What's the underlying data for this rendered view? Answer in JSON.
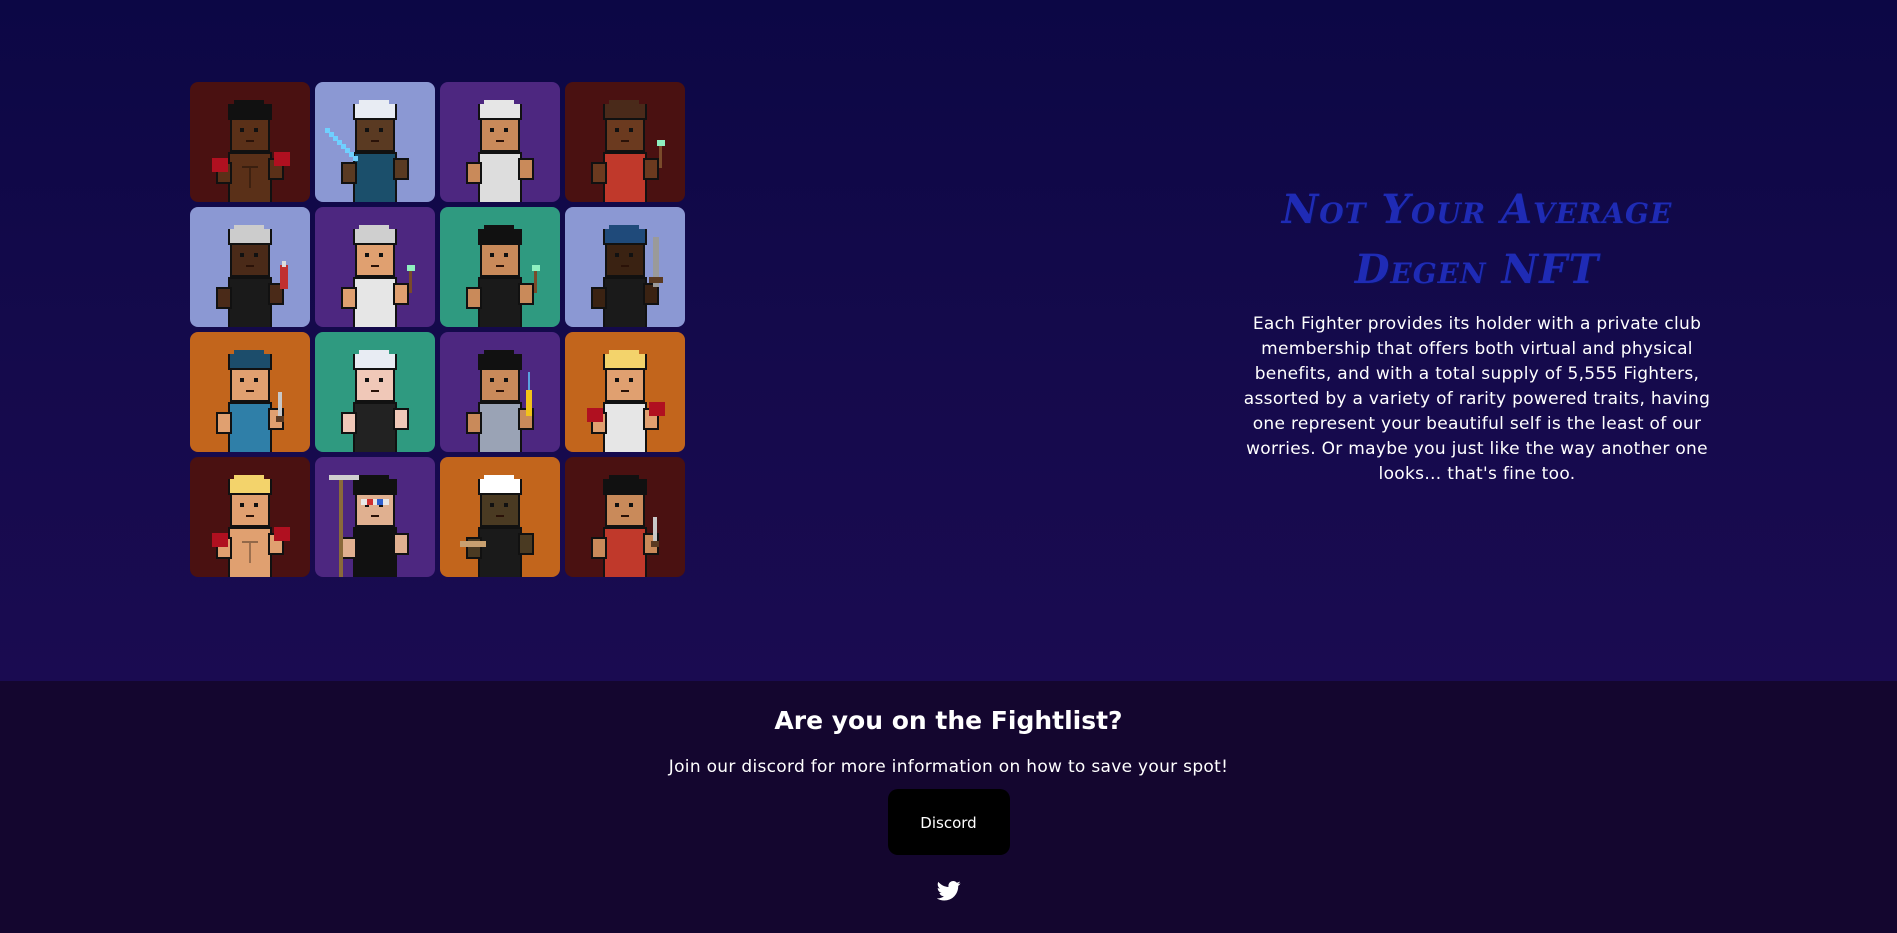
{
  "hero": {
    "headline_line1": "Not Your Average",
    "headline_line2": "Degen NFT",
    "description": "Each Fighter provides its holder with a private club membership that offers both virtual and physical benefits, and with a total supply of 5,555 Fighters, assorted by a variety of rarity powered traits, having one represent your beautiful self is the least of our worries. Or maybe you just like the way another one looks… that's fine too.",
    "headline_color": "#1f2bb5"
  },
  "gallery": {
    "tiles": [
      {
        "bg": "#4a1111",
        "skin": "#5a3018",
        "hair": "#111111",
        "shirt": "none",
        "item": "gloves"
      },
      {
        "bg": "#8b98d3",
        "skin": "#5a3a22",
        "hair": "#e8ecf3",
        "shirt": "#1b4f6b",
        "item": "saber"
      },
      {
        "bg": "#4d2780",
        "skin": "#c98a5a",
        "hair": "#e6e6e6",
        "shirt": "#dddddd",
        "item": "none"
      },
      {
        "bg": "#4a1111",
        "skin": "#6b3a1f",
        "hair": "#4a2a1a",
        "shirt": "#c0392b",
        "item": "wand"
      },
      {
        "bg": "#8b98d3",
        "skin": "#4a2a18",
        "hair": "#cccccc",
        "shirt": "#1a1a1a",
        "item": "bottle"
      },
      {
        "bg": "#4d2780",
        "skin": "#e0a070",
        "hair": "#cfcfcf",
        "shirt": "#e6e6e6",
        "item": "wand"
      },
      {
        "bg": "#2f9a80",
        "skin": "#c98a5a",
        "hair": "#111111",
        "shirt": "#1a1a1a",
        "item": "wand"
      },
      {
        "bg": "#8b98d3",
        "skin": "#3a2212",
        "hair": "#1f4a7a",
        "shirt": "#1a1a1a",
        "item": "gun"
      },
      {
        "bg": "#c2651c",
        "skin": "#e0a070",
        "hair": "#1c4d6b",
        "shirt": "#2f7fa8",
        "item": "knife"
      },
      {
        "bg": "#2f9a80",
        "skin": "#f0c8b8",
        "hair": "#e8ecf3",
        "shirt": "#222222",
        "item": "none"
      },
      {
        "bg": "#4d2780",
        "skin": "#c98a5a",
        "hair": "#111111",
        "shirt": "#9aa3b5",
        "item": "banana"
      },
      {
        "bg": "#c2651c",
        "skin": "#e0a070",
        "hair": "#f3d36b",
        "shirt": "#e6e6e6",
        "item": "gloves"
      },
      {
        "bg": "#4a1111",
        "skin": "#e0a070",
        "hair": "#f3d36b",
        "shirt": "none",
        "item": "gloves"
      },
      {
        "bg": "#4d2780",
        "skin": "#e0b090",
        "hair": "#111111",
        "shirt": "#111111",
        "item": "scythe"
      },
      {
        "bg": "#c2651c",
        "skin": "#4a3a22",
        "hair": "#ffffff",
        "shirt": "#1a1a1a",
        "item": "bat"
      },
      {
        "bg": "#4a1111",
        "skin": "#c98a5a",
        "hair": "#111111",
        "shirt": "#c0392b",
        "item": "knife"
      }
    ]
  },
  "footer": {
    "title": "Are you on the Fightlist?",
    "subtitle": "Join our discord for more information on how to save your spot!",
    "discord_label": "Discord",
    "twitter_icon": "twitter-icon"
  }
}
